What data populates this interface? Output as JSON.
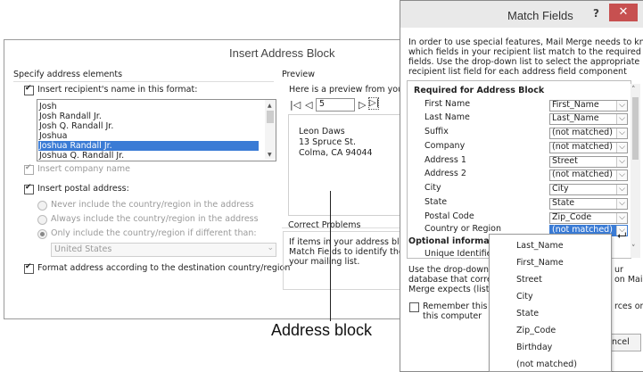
{
  "insert_address_block": {
    "title": "Insert Address Block",
    "specify_header": "Specify address elements",
    "name_checkbox_label": "Insert recipient's name in this format:",
    "name_formats": [
      "Josh",
      "Josh Randall Jr.",
      "Josh Q. Randall Jr.",
      "Joshua",
      "Joshua Randall Jr.",
      "Joshua Q. Randall Jr."
    ],
    "selected_format": "Joshua Randall Jr.",
    "company_label": "Insert company name",
    "postal_label": "Insert postal address:",
    "radio_never": "Never include the country/region in the address",
    "radio_always": "Always include the country/region in the address",
    "radio_only": "Only include the country/region if different than:",
    "country_value": "United States",
    "format_label": "Format address according to the destination country/region",
    "preview_header": "Preview",
    "preview_intro": "Here is a preview from your",
    "record_number": "5",
    "preview_lines": [
      "Leon Daws",
      "13 Spruce St.",
      "Colma, CA 94044"
    ],
    "correct_header": "Correct Problems",
    "correct_text": [
      "If items in your address bloc",
      "Match Fields to identify the",
      "your mailing list."
    ]
  },
  "callout": {
    "label": "Address block"
  },
  "match_fields": {
    "title": "Match Fields",
    "help": "?",
    "close": "✕",
    "intro": [
      "In order to use special features, Mail Merge needs to know",
      "which fields in your recipient list match to the required",
      "fields.  Use the drop-down list to select the appropriate",
      "recipient list field for each address field component"
    ],
    "required_header": "Required for Address Block",
    "rows": [
      {
        "label": "First Name",
        "value": "First_Name"
      },
      {
        "label": "Last Name",
        "value": "Last_Name"
      },
      {
        "label": "Suffix",
        "value": "(not matched)"
      },
      {
        "label": "Company",
        "value": "(not matched)"
      },
      {
        "label": "Address 1",
        "value": "Street"
      },
      {
        "label": "Address 2",
        "value": "(not matched)"
      },
      {
        "label": "City",
        "value": "City"
      },
      {
        "label": "State",
        "value": "State"
      },
      {
        "label": "Postal Code",
        "value": "Zip_Code"
      },
      {
        "label": "Country or Region",
        "value": "(not matched)"
      }
    ],
    "optional_header": "Optional informati",
    "unique_label": "Unique Identifie",
    "bottom_text": [
      "Use the drop-down",
      "database that corre",
      "Merge expects (liste"
    ],
    "bottom_right": [
      "ur",
      "on Mail"
    ],
    "remember_label": [
      "Remember this n",
      "this computer"
    ],
    "remember_right": "rces on",
    "cancel_fragment": "ncel"
  },
  "dropdown_options": [
    "Last_Name",
    "First_Name",
    "Street",
    "City",
    "State",
    "Zip_Code",
    "Birthday",
    "(not matched)"
  ],
  "colors": {
    "selection": "#3a7bd5",
    "close_red": "#c75050"
  }
}
